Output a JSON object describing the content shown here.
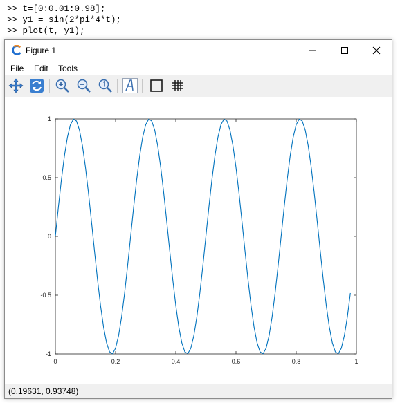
{
  "console": {
    "lines": [
      ">> t=[0:0.01:0.98];",
      ">> y1 = sin(2*pi*4*t);",
      ">> plot(t, y1);"
    ]
  },
  "window": {
    "title": "Figure 1",
    "controls": {
      "minimize": "minimize-icon",
      "maximize": "maximize-icon",
      "close": "close-icon"
    }
  },
  "menu": [
    "File",
    "Edit",
    "Tools"
  ],
  "toolbar": [
    {
      "name": "pan-icon"
    },
    {
      "name": "rotate-icon"
    },
    {
      "name": "zoom-in-icon"
    },
    {
      "name": "zoom-out-icon"
    },
    {
      "name": "zoom-reset-icon"
    },
    {
      "name": "text-icon"
    },
    {
      "name": "axes-box-icon"
    },
    {
      "name": "grid-icon"
    }
  ],
  "status": "(0.19631, 0.93748)",
  "colors": {
    "line": "#0072bd",
    "toolbar_bg": "#f0f0f0",
    "accent": "#1f6fd0"
  },
  "chart_data": {
    "type": "line",
    "function": "sin(2*pi*4*t)",
    "x_start": 0,
    "x_step": 0.01,
    "x_end": 0.98,
    "xlim": [
      0,
      1
    ],
    "ylim": [
      -1,
      1
    ],
    "xticks": [
      "0",
      "0.2",
      "0.4",
      "0.6",
      "0.8",
      "1"
    ],
    "yticks": [
      "1",
      "0.5",
      "0",
      "-0.5",
      "-1"
    ],
    "title": "",
    "xlabel": "",
    "ylabel": "",
    "grid": false
  }
}
